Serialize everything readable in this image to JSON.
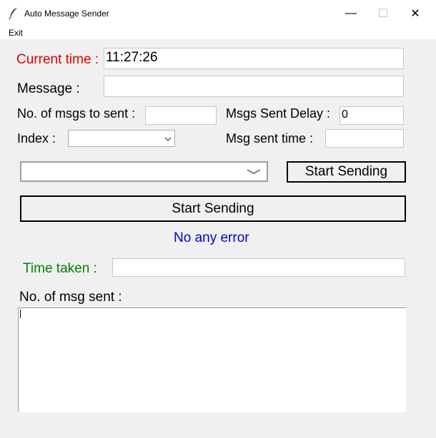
{
  "window": {
    "title": "Auto Message Sender",
    "minimize_glyph": "—",
    "maximize_glyph": "☐",
    "close_glyph": "✕"
  },
  "menu": {
    "items": [
      "Exit"
    ]
  },
  "form": {
    "current_time_label": "Current time :",
    "current_time_value": "11:27:26",
    "message_label": "Message :",
    "message_value": "",
    "num_msgs_label": "No. of msgs to sent :",
    "num_msgs_value": "",
    "delay_label": "Msgs Sent Delay :",
    "delay_value": "0",
    "index_label": "Index :",
    "index_value": "",
    "msg_sent_time_label": "Msg sent time :",
    "msg_sent_time_value": "",
    "combo_value": "",
    "start_button_small": "Start Sending",
    "start_button_large": "Start Sending",
    "status_text": "No any error",
    "time_taken_label": "Time taken :",
    "time_taken_value": "",
    "msgs_sent_label": "No. of msg sent :",
    "msgs_sent_value": ""
  },
  "colors": {
    "current_time_label": "#e00000",
    "status_text": "#0000d0",
    "time_taken_label": "#008000"
  },
  "icons": {
    "app": "feather-icon",
    "dropdown": "chevron-down-icon"
  }
}
